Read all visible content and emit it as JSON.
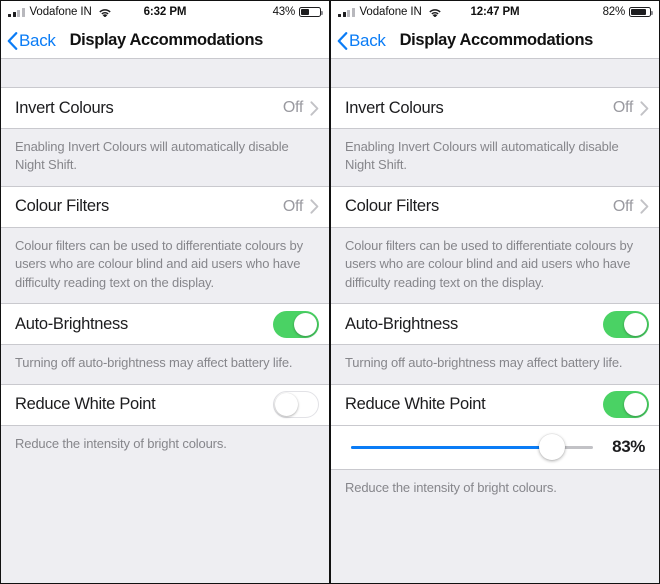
{
  "panels": [
    {
      "id": "left",
      "status_bar": {
        "carrier": "Vodafone IN",
        "signal_icon": "cellular-signal-icon",
        "wifi_icon": "wifi-icon",
        "time": "6:32 PM",
        "battery_percent_label": "43%",
        "battery_level": 43,
        "battery_icon": "battery-icon"
      },
      "nav": {
        "back_label": "Back",
        "back_icon": "chevron-left-icon",
        "title": "Display Accommodations"
      },
      "rows": [
        {
          "key": "invert-colours",
          "label": "Invert Colours",
          "type": "disclosure",
          "value": "Off",
          "chevron_icon": "chevron-right-icon",
          "footnote": "Enabling Invert Colours will automatically disable Night Shift."
        },
        {
          "key": "colour-filters",
          "label": "Colour Filters",
          "type": "disclosure",
          "value": "Off",
          "chevron_icon": "chevron-right-icon",
          "footnote": "Colour filters can be used to differentiate colours by users who are colour blind and aid users who have difficulty reading text on the display."
        },
        {
          "key": "auto-brightness",
          "label": "Auto-Brightness",
          "type": "toggle",
          "toggle_on": true,
          "footnote": "Turning off auto-brightness may affect battery life."
        },
        {
          "key": "reduce-white-point",
          "label": "Reduce White Point",
          "type": "toggle",
          "toggle_on": false,
          "slider": null,
          "footnote": "Reduce the intensity of bright colours."
        }
      ]
    },
    {
      "id": "right",
      "status_bar": {
        "carrier": "Vodafone IN",
        "signal_icon": "cellular-signal-icon",
        "wifi_icon": "wifi-icon",
        "time": "12:47 PM",
        "battery_percent_label": "82%",
        "battery_level": 82,
        "battery_icon": "battery-icon"
      },
      "nav": {
        "back_label": "Back",
        "back_icon": "chevron-left-icon",
        "title": "Display Accommodations"
      },
      "rows": [
        {
          "key": "invert-colours",
          "label": "Invert Colours",
          "type": "disclosure",
          "value": "Off",
          "chevron_icon": "chevron-right-icon",
          "footnote": "Enabling Invert Colours will automatically disable Night Shift."
        },
        {
          "key": "colour-filters",
          "label": "Colour Filters",
          "type": "disclosure",
          "value": "Off",
          "chevron_icon": "chevron-right-icon",
          "footnote": "Colour filters can be used to differentiate colours by users who are colour blind and aid users who have difficulty reading text on the display."
        },
        {
          "key": "auto-brightness",
          "label": "Auto-Brightness",
          "type": "toggle",
          "toggle_on": true,
          "footnote": "Turning off auto-brightness may affect battery life."
        },
        {
          "key": "reduce-white-point",
          "label": "Reduce White Point",
          "type": "toggle",
          "toggle_on": true,
          "slider": {
            "value_label": "83%",
            "value": 83,
            "min": 0,
            "max": 100
          },
          "footnote": "Reduce the intensity of bright colours."
        }
      ]
    }
  ],
  "colors": {
    "accent_blue": "#0a7cf6",
    "toggle_green": "#4ad264",
    "slider_blue": "#0a7cf6",
    "group_background": "#eeeef2",
    "row_background": "#ffffff",
    "secondary_text": "#86868b",
    "value_text": "#9a9aa0"
  }
}
